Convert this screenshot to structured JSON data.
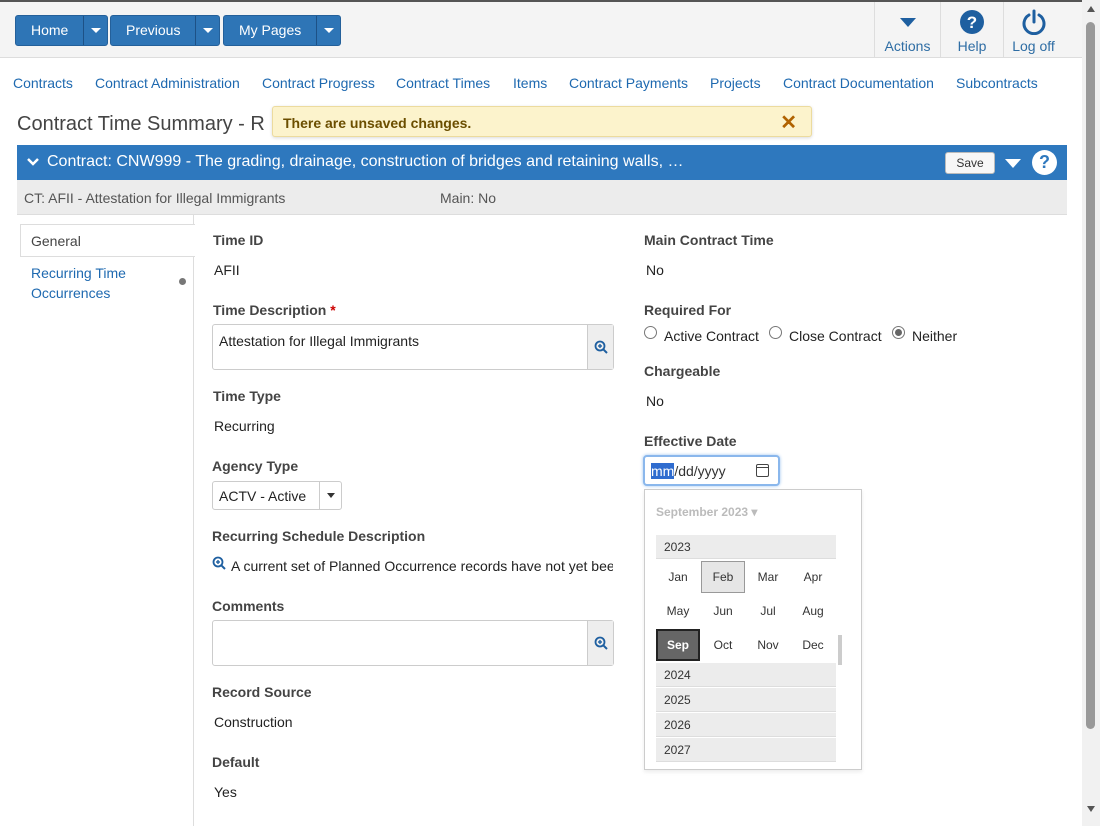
{
  "toolbar": {
    "home_label": "Home",
    "previous_label": "Previous",
    "mypages_label": "My Pages",
    "actions_label": "Actions",
    "help_label": "Help",
    "logoff_label": "Log off"
  },
  "nav": [
    "Contracts",
    "Contract Administration",
    "Contract Progress",
    "Contract Times",
    "Items",
    "Contract Payments",
    "Projects",
    "Contract Documentation",
    "Subcontracts"
  ],
  "page": {
    "title": "Contract Time Summary - R",
    "toast_message": "There are unsaved changes."
  },
  "contract": {
    "header": "Contract: CNW999 - The grading, drainage, construction of bridges and retaining walls, …",
    "save_label": "Save",
    "ct_info": "CT: AFII - Attestation for Illegal Immigrants",
    "main_info": "Main: No"
  },
  "tabs": {
    "general": "General",
    "recurring": "Recurring Time Occurrences"
  },
  "form": {
    "time_id_label": "Time ID",
    "time_id_value": "AFII",
    "time_desc_label": "Time Description",
    "required_mark": "*",
    "time_desc_value": "Attestation for Illegal Immigrants",
    "time_type_label": "Time Type",
    "time_type_value": "Recurring",
    "agency_type_label": "Agency Type",
    "agency_type_value": "ACTV - Active",
    "recurring_sched_label": "Recurring Schedule Description",
    "recurring_sched_value": "A current set of Planned Occurrence records have not yet bee",
    "comments_label": "Comments",
    "comments_value": "",
    "record_source_label": "Record Source",
    "record_source_value": "Construction",
    "default_label": "Default",
    "default_value": "Yes",
    "main_contract_time_label": "Main Contract Time",
    "main_contract_time_value": "No",
    "required_for_label": "Required For",
    "required_for_options": [
      "Active Contract",
      "Close Contract",
      "Neither"
    ],
    "required_for_selected": "Neither",
    "chargeable_label": "Chargeable",
    "chargeable_value": "No",
    "effective_date_label": "Effective Date",
    "effective_date_seg1": "mm",
    "effective_date_rest": "/dd/yyyy"
  },
  "picker": {
    "header": "September 2023 ▾",
    "year_current": "2023",
    "months": [
      "Jan",
      "Feb",
      "Mar",
      "Apr",
      "May",
      "Jun",
      "Jul",
      "Aug",
      "Sep",
      "Oct",
      "Nov",
      "Dec"
    ],
    "selected_month": "Sep",
    "hover_month": "Feb",
    "years_after": [
      "2024",
      "2025",
      "2026",
      "2027"
    ]
  },
  "colors": {
    "primary_blue": "#2e78be",
    "link_blue": "#1e69b0",
    "toast_bg": "#fcf3cc"
  }
}
